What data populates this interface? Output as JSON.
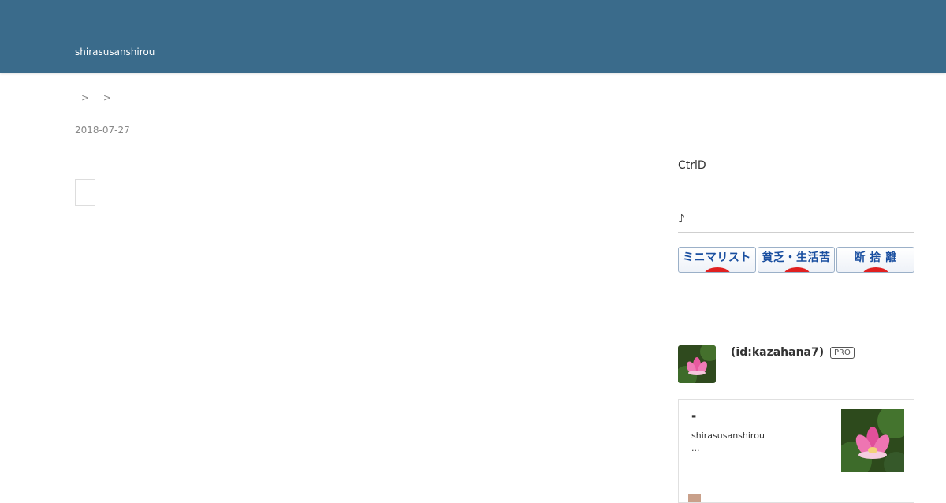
{
  "header": {
    "blog_title": "shirasusanshirou"
  },
  "breadcrumb": {
    "separators": [
      ">",
      ">"
    ]
  },
  "entry": {
    "date": "2018-07-27"
  },
  "sidebar": {
    "ctrl_text": "CtrlD",
    "note_text": "♪",
    "banners": [
      {
        "label": "ミニマリスト"
      },
      {
        "label": "貧乏・生活苦"
      },
      {
        "label": "断 捨 離"
      }
    ],
    "profile": {
      "name": "(id:kazahana7)",
      "badge": "PRO"
    },
    "card": {
      "title": "-",
      "author": "shirasusanshirou",
      "description": "..."
    }
  },
  "colors": {
    "header_bg": "#3a6b8b",
    "banner_text": "#1a4fa0",
    "banner_dot": "#e02020"
  }
}
